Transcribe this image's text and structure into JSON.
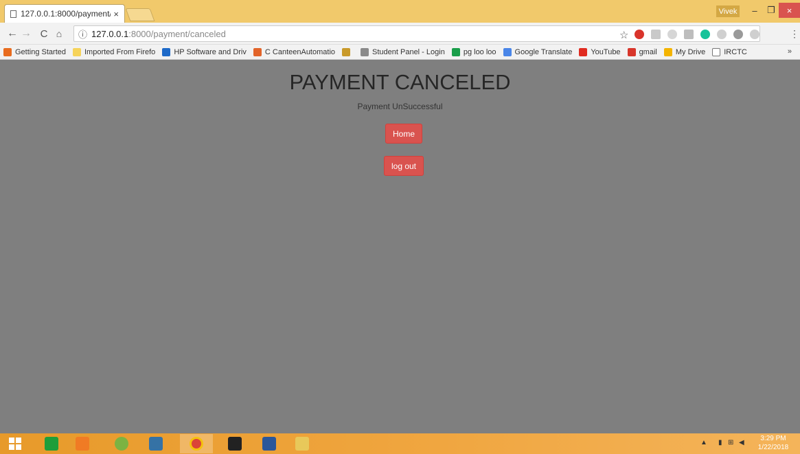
{
  "browser": {
    "tab_title": "127.0.0.1:8000/payment/",
    "tab_close": "×",
    "profile_name": "Vivek",
    "window_controls": {
      "minimize": "–",
      "maximize": "❐",
      "close": "×"
    },
    "nav": {
      "back": "←",
      "forward": "→",
      "reload": "C",
      "home": "⌂"
    },
    "url_host": "127.0.0.1",
    "url_rest": ":8000/payment/canceled",
    "info_icon": "ⓘ",
    "star": "☆",
    "menu": "⋮",
    "bookmarks_more": "»",
    "bookmarks": [
      {
        "label": "Getting Started",
        "color": "#e86c1f"
      },
      {
        "label": "Imported From Firefo",
        "color": "#f6d35a"
      },
      {
        "label": "HP Software and Driv",
        "color": "#1e6ac9"
      },
      {
        "label": "C CanteenAutomatio",
        "color": "#e2642a"
      },
      {
        "label": "",
        "color": "#c99a2a"
      },
      {
        "label": "Student Panel - Login",
        "color": "#8a8a8a"
      },
      {
        "label": "pg loo loo",
        "color": "#1a9e4a"
      },
      {
        "label": "Google Translate",
        "color": "#4a86e8"
      },
      {
        "label": "YouTube",
        "color": "#e02b20"
      },
      {
        "label": "gmail",
        "color": "#d8362b"
      },
      {
        "label": "My Drive",
        "color": "#f4b400"
      },
      {
        "label": "IRCTC",
        "color": "#ffffff"
      }
    ]
  },
  "page": {
    "heading": "PAYMENT CANCELED",
    "subtext": "Payment UnSuccessful",
    "home_button": "Home",
    "logout_button": "log out"
  },
  "taskbar": {
    "time": "3:29 PM",
    "date": "1/22/2018"
  },
  "colors": {
    "page_bg": "#7f7f7f",
    "button_red": "#d9534f",
    "chrome_frame": "#f1c96b"
  }
}
